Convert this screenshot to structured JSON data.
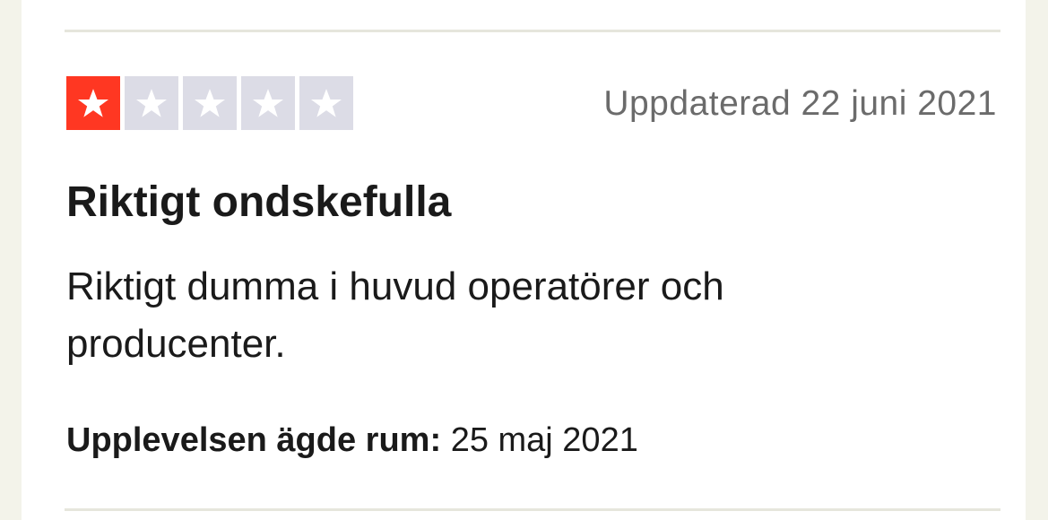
{
  "review": {
    "rating": 1,
    "rating_max": 5,
    "star_colors": {
      "active": "#ff3722",
      "inactive": "#dcdce6",
      "glyph": "#ffffff"
    },
    "updated_date": "Uppdaterad 22 juni 2021",
    "title": "Riktigt ondskefulla",
    "body": "Riktigt dumma i huvud operatörer och producenter.",
    "experience_label": "Upplevelsen ägde rum:",
    "experience_date": "25 maj 2021"
  }
}
